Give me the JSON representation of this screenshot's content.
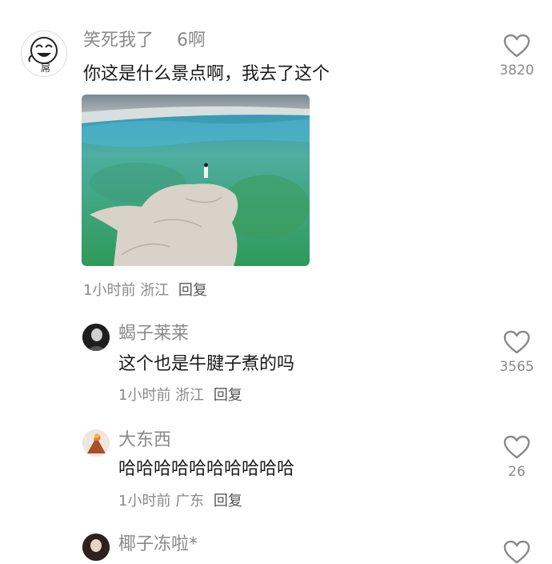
{
  "comments": [
    {
      "username": "笑死我了",
      "badge": "6啊",
      "text": "你这是什么景点啊，我去了这个",
      "time": "1小时前",
      "location": "浙江",
      "reply_label": "回复",
      "likes": "3820",
      "avatar_icon": "laughing-face-icon",
      "has_image": true,
      "image_icon": "salt-lake-photo"
    },
    {
      "username": "蝎子莱莱",
      "text": "这个也是牛腱子煮的吗",
      "time": "1小时前",
      "location": "浙江",
      "reply_label": "回复",
      "likes": "3565",
      "avatar_icon": "dark-portrait-avatar"
    },
    {
      "username": "大东西",
      "text": "哈哈哈哈哈哈哈哈哈哈",
      "time": "1小时前",
      "location": "广东",
      "reply_label": "回复",
      "likes": "26",
      "avatar_icon": "volcano-avatar"
    },
    {
      "username": "椰子冻啦*",
      "avatar_icon": "person-avatar"
    }
  ],
  "colors": {
    "username": "#8a8a8a",
    "text": "#1a1a1a",
    "heart_outline": "#8a8a8a",
    "lake_green": "#3fa36a",
    "lake_blue": "#2f8fc2"
  }
}
